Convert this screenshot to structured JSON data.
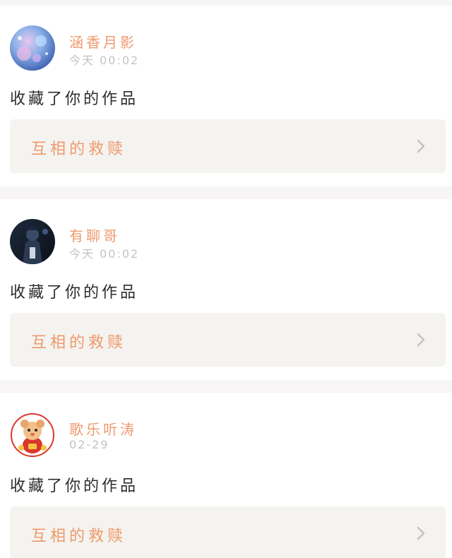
{
  "notifications": [
    {
      "username": "涵香月影",
      "time": "今天 00:02",
      "action": "收藏了你的作品",
      "work_title": "互相的救赎"
    },
    {
      "username": "有聊哥",
      "time": "今天 00:02",
      "action": "收藏了你的作品",
      "work_title": "互相的救赎"
    },
    {
      "username": "歌乐听涛",
      "time": "02-29",
      "action": "收藏了你的作品",
      "work_title": "互相的救赎"
    }
  ],
  "icons": {
    "chevron": "chevron-right-icon"
  },
  "colors": {
    "accent": "#ef9a6c",
    "muted": "#c6c2c2",
    "text": "#2c2c2c",
    "work_box_bg": "#f4f3ef",
    "page_bg": "#f7f5f5"
  }
}
